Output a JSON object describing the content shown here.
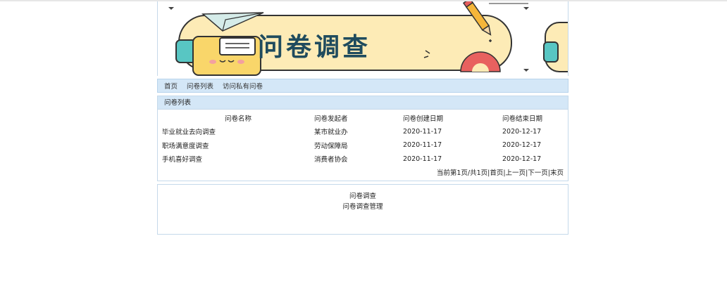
{
  "banner": {
    "title": "问卷调查"
  },
  "nav": {
    "items": [
      "首页",
      "问卷列表",
      "访问私有问卷"
    ]
  },
  "list": {
    "title": "问卷列表",
    "columns": [
      "问卷名称",
      "问卷发起者",
      "问卷创建日期",
      "问卷结束日期"
    ],
    "rows": [
      [
        "毕业就业去向调查",
        "某市就业办",
        "2020-11-17",
        "2020-12-17"
      ],
      [
        "职场满意度调查",
        "劳动保障局",
        "2020-11-17",
        "2020-12-17"
      ],
      [
        "手机喜好调查",
        "消费者协会",
        "2020-11-17",
        "2020-12-17"
      ]
    ],
    "pager": {
      "status": "当前第1页/共1页",
      "first": "首页",
      "prev": "上一页",
      "next": "下一页",
      "last": "末页",
      "sep": "|"
    }
  },
  "footer": {
    "line1": "问卷调查",
    "line2": "问卷调查管理"
  }
}
